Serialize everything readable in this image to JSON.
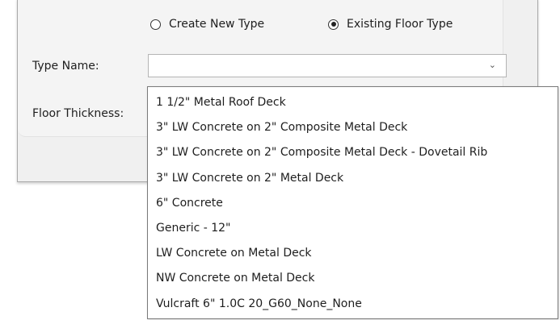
{
  "form": {
    "radio_create_label": "Create New Type",
    "radio_existing_label": "Existing Floor Type",
    "radio_selected": "existing",
    "type_name_label": "Type Name:",
    "floor_thickness_label": "Floor Thickness:",
    "type_name_value": ""
  },
  "dropdown": {
    "options": [
      "1 1/2\" Metal Roof Deck",
      "3\" LW Concrete on 2\" Composite Metal Deck",
      "3\" LW Concrete on 2\" Composite Metal Deck - Dovetail Rib",
      "3\" LW Concrete on 2\" Metal Deck",
      "6\" Concrete",
      "Generic - 12\"",
      "LW Concrete on Metal Deck",
      "NW Concrete on Metal Deck",
      "Vulcraft 6\" 1.0C 20_G60_None_None"
    ]
  },
  "icons": {
    "combo_arrow": "chevron-down-icon"
  }
}
